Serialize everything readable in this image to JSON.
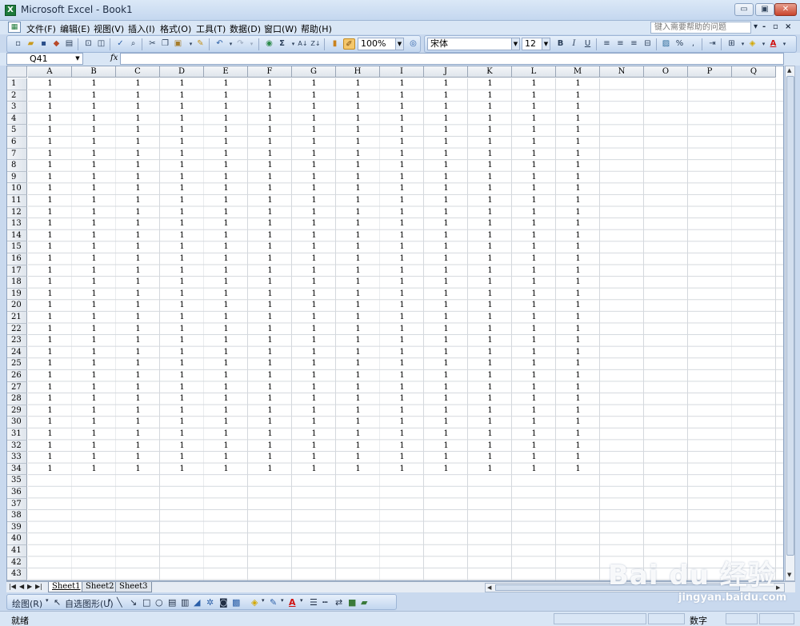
{
  "window": {
    "title": "Microsoft Excel - Book1",
    "min": "▭",
    "max": "▣",
    "close": "✕"
  },
  "menu": {
    "items": [
      "文件(F)",
      "编辑(E)",
      "视图(V)",
      "插入(I)",
      "格式(O)",
      "工具(T)",
      "数据(D)",
      "窗口(W)",
      "帮助(H)"
    ],
    "help_placeholder": "键入需要帮助的问题",
    "doc_min": "-",
    "doc_restore": "▫",
    "doc_close": "×"
  },
  "toolbar": {
    "zoom": "100%",
    "font": "宋体",
    "font_size": "12",
    "bold": "B",
    "italic": "I",
    "underline": "U",
    "percent": "%",
    "comma": ","
  },
  "formula": {
    "cell_ref": "Q41",
    "fx": "fx",
    "value": ""
  },
  "sheet": {
    "columns": [
      "A",
      "B",
      "C",
      "D",
      "E",
      "F",
      "G",
      "H",
      "I",
      "J",
      "K",
      "L",
      "M",
      "N",
      "O",
      "P",
      "Q"
    ],
    "rows": [
      "1",
      "2",
      "3",
      "4",
      "5",
      "6",
      "7",
      "8",
      "9",
      "10",
      "11",
      "12",
      "13",
      "14",
      "15",
      "16",
      "17",
      "18",
      "19",
      "20",
      "21",
      "22",
      "23",
      "24",
      "25",
      "26",
      "27",
      "28",
      "29",
      "30",
      "31",
      "32",
      "33",
      "34",
      "35",
      "36",
      "37",
      "38",
      "39",
      "40",
      "41",
      "42",
      "43"
    ],
    "filled_rows": 34,
    "filled_cols": 13,
    "cell_value": "1"
  },
  "tabs": {
    "sheets": [
      "Sheet1",
      "Sheet2",
      "Sheet3"
    ],
    "active": "Sheet1"
  },
  "drawing": {
    "draw_label": "绘图(R)",
    "autoshape_label": "自选图形(U)"
  },
  "status": {
    "ready": "就绪",
    "mode": "数字"
  },
  "watermark": {
    "logo": "Bai du 经验",
    "url": "jingyan.baidu.com"
  }
}
